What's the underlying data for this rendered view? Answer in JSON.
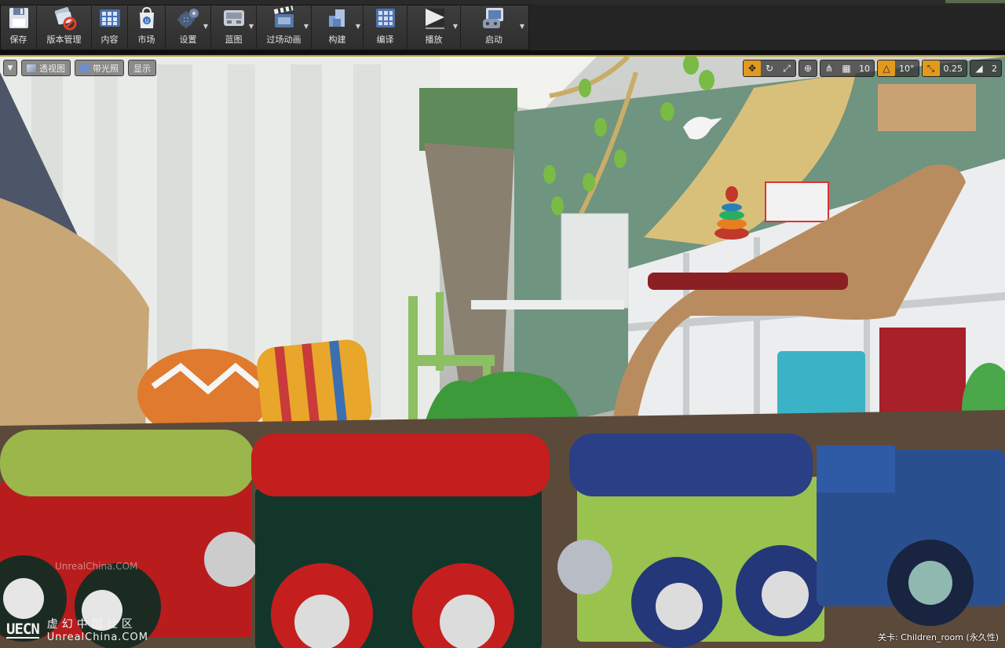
{
  "toolbar": {
    "items": [
      {
        "label": "保存",
        "icon": "save-icon",
        "dropdown": false
      },
      {
        "label": "版本管理",
        "icon": "source-control-icon",
        "dropdown": false
      },
      {
        "label": "内容",
        "icon": "content-browser-icon",
        "dropdown": false
      },
      {
        "label": "市场",
        "icon": "marketplace-icon",
        "dropdown": false
      },
      {
        "label": "设置",
        "icon": "settings-icon",
        "dropdown": true
      },
      {
        "label": "蓝图",
        "icon": "blueprint-icon",
        "dropdown": true
      },
      {
        "label": "过场动画",
        "icon": "cinematics-icon",
        "dropdown": true
      },
      {
        "label": "构建",
        "icon": "build-icon",
        "dropdown": true
      },
      {
        "label": "编译",
        "icon": "compile-icon",
        "dropdown": false
      },
      {
        "label": "播放",
        "icon": "play-icon",
        "dropdown": true
      },
      {
        "label": "启动",
        "icon": "launch-icon",
        "dropdown": true
      }
    ]
  },
  "viewport": {
    "view_mode": "透视图",
    "lighting_mode": "带光照",
    "show_label": "显示",
    "grid_snap_value": "10",
    "rotation_snap_value": "10°",
    "scale_snap_value": "0.25",
    "camera_speed_value": "2",
    "level_info": "关卡:  Children_room (永久性)",
    "watermark_small": "UnrealChina.COM",
    "watermark_logo": "UECN",
    "watermark_cn": "虚幻中国社区",
    "watermark_en": "UnrealChina.COM"
  },
  "colors": {
    "accent": "#e29a1e",
    "viewport_border": "#b79a2a",
    "toolbar_bg": "#353535"
  }
}
